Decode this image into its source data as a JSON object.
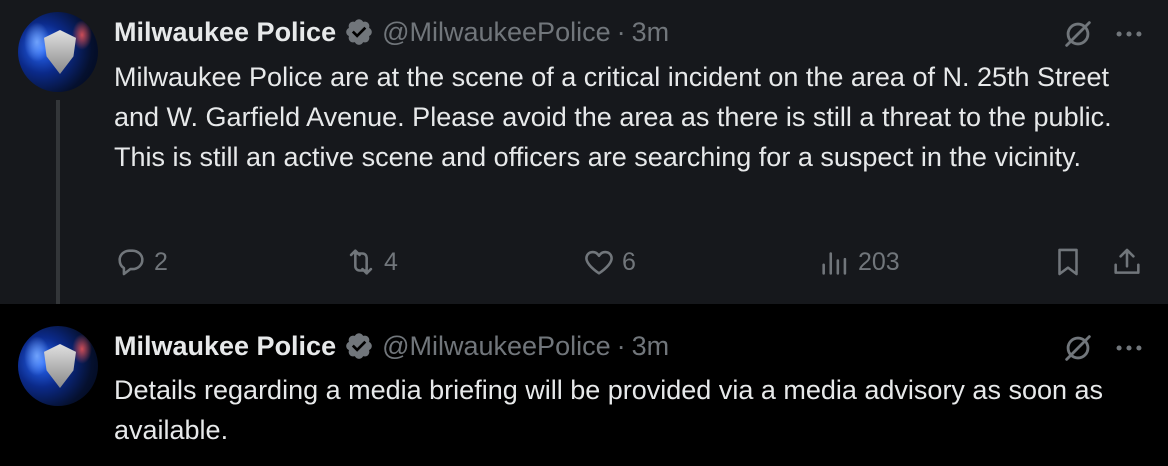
{
  "tweets": [
    {
      "author_name": "Milwaukee Police",
      "handle": "@MilwaukeePolice",
      "separator": "·",
      "time": "3m",
      "text": "Milwaukee Police are at the scene of a critical incident on the area of N. 25th Street and W. Garfield Avenue. Please avoid the area as there is still a threat to the public. This is still an active scene and officers are searching for a suspect in the vicinity.",
      "stats": {
        "replies": "2",
        "reposts": "4",
        "likes": "6",
        "views": "203"
      }
    },
    {
      "author_name": "Milwaukee Police",
      "handle": "@MilwaukeePolice",
      "separator": "·",
      "time": "3m",
      "text": "Details regarding a media briefing will be provided via a media advisory as soon as available."
    }
  ],
  "colors": {
    "verified_badge": "#1d9bf0",
    "muted_text": "#71767b",
    "primary_text": "#e7e9ea",
    "highlight_bg": "#16181c"
  },
  "icons": [
    "verified-icon",
    "grok-icon",
    "more-icon",
    "reply-icon",
    "repost-icon",
    "like-icon",
    "views-icon",
    "bookmark-icon",
    "share-icon"
  ]
}
